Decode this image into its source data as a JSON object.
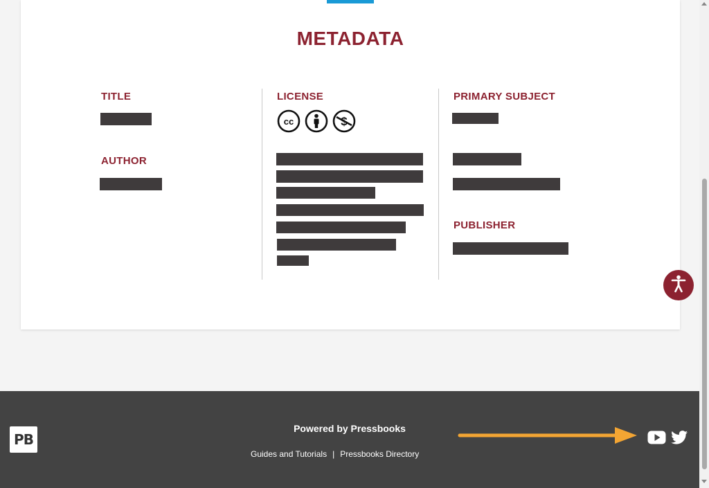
{
  "metadata": {
    "heading": "METADATA",
    "title_label": "TITLE",
    "author_label": "AUTHOR",
    "license_label": "LICENSE",
    "primary_subject_label": "PRIMARY SUBJECT",
    "publisher_label": "PUBLISHER"
  },
  "icons": {
    "license": [
      "creative-commons-icon",
      "attribution-icon",
      "noncommercial-icon"
    ],
    "accessibility": "accessibility-icon",
    "social": [
      "youtube-icon",
      "twitter-icon"
    ],
    "annotation": "orange-arrow"
  },
  "footer": {
    "logo_text": "PB",
    "powered_by": "Powered by Pressbooks",
    "link_guides": "Guides and Tutorials",
    "separator": "|",
    "link_directory": "Pressbooks Directory"
  },
  "colors": {
    "accent": "#8c2230",
    "top_bar": "#1a9ad6",
    "footer_bg": "#434343",
    "arrow": "#f3a533",
    "redaction": "#3f3b3c"
  }
}
